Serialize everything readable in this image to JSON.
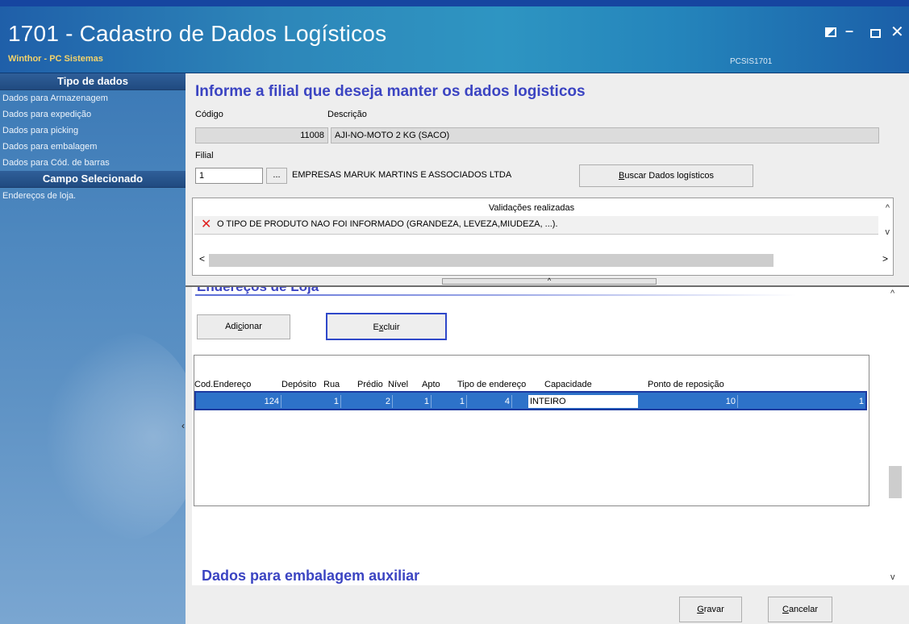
{
  "window": {
    "title": "1701 - Cadastro de Dados Logísticos",
    "subtitle": "Winthor - PC Sistemas",
    "program_code": "PCSIS1701",
    "controls": {
      "restore": "restore-icon",
      "minimize": "–",
      "maximize": "□",
      "close": "✕"
    }
  },
  "sidebar": {
    "header1": "Tipo de dados",
    "items": [
      "Dados para Armazenagem",
      "Dados para expedição",
      "Dados para picking",
      "Dados para embalagem",
      "Dados para Cód. de barras"
    ],
    "header2": "Campo Selecionado",
    "selected": "Endereços de loja.",
    "grip": "‹"
  },
  "main": {
    "heading": "Informe a filial que deseja manter os dados logisticos",
    "codigo_label": "Código",
    "descricao_label": "Descrição",
    "codigo_value": "11008",
    "descricao_value": "AJI-NO-MOTO 2 KG (SACO)",
    "filial_label": "Filial",
    "filial_value": "1",
    "filial_lookup": "...",
    "filial_name": "EMPRESAS MARUK MARTINS E ASSOCIADOS LTDA",
    "buscar_button": {
      "underlined": "B",
      "rest": "uscar Dados logísticos"
    }
  },
  "validations": {
    "title": "Validações realizadas",
    "items": [
      "O TIPO DE PRODUTO NAO FOI INFORMADO (GRANDEZA, LEVEZA,MIUDEZA, ...)."
    ],
    "scroll_left": "<",
    "scroll_right": ">",
    "scroll_up": "^",
    "scroll_down": "v"
  },
  "splitter": {
    "arrow": "^"
  },
  "enderecos": {
    "section_title": "Endereços de Loja",
    "add_button": {
      "pre": "Adi",
      "underlined": "c",
      "post": "ionar"
    },
    "delete_button": {
      "pre": "E",
      "underlined": "x",
      "post": "cluir"
    },
    "columns": [
      "Cod.Endereço",
      "Depósito",
      "Rua",
      "Prédio",
      "Nível",
      "Apto",
      "Tipo de endereço",
      "Capacidade",
      "Ponto de reposição"
    ],
    "rows": [
      {
        "cod_endereco": "124",
        "deposito": "1",
        "rua": "2",
        "predio": "1",
        "nivel": "1",
        "apto": "4",
        "tipo": "INTEIRO",
        "capacidade": "10",
        "ponto_reposicao": "1"
      }
    ],
    "scroll_up": "^",
    "scroll_down": "v"
  },
  "next_section": "Dados para embalagem auxiliar",
  "footer": {
    "save_button": {
      "underlined": "G",
      "rest": "ravar"
    },
    "cancel_button": {
      "underlined": "C",
      "rest": "ancelar"
    }
  }
}
